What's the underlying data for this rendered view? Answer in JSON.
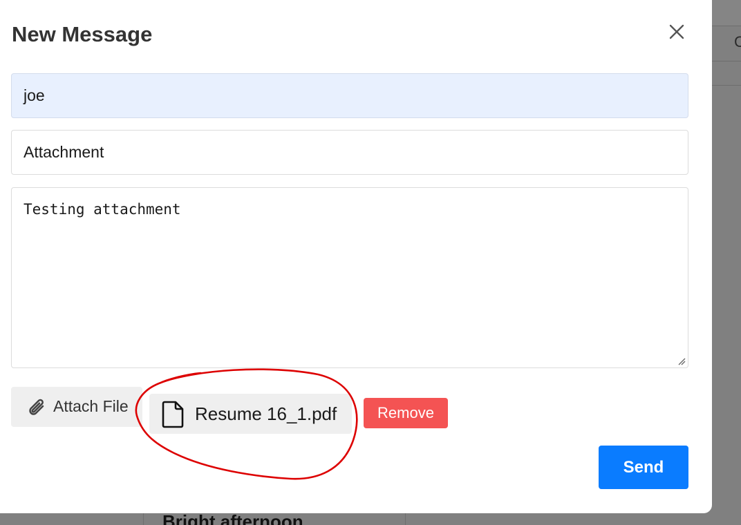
{
  "modal": {
    "title": "New Message",
    "close_icon": "close-icon"
  },
  "form": {
    "to_value": "joe",
    "subject_value": "Attachment",
    "body_value": "Testing attachment"
  },
  "attachments": {
    "attach_button_label": "Attach File",
    "attach_icon": "paperclip-icon",
    "file_icon": "file-icon",
    "file_name": "Resume 16_1.pdf",
    "remove_button_label": "Remove"
  },
  "actions": {
    "send_label": "Send"
  },
  "background": {
    "partial_heading": "Bright afternoon",
    "partial_glyph": "C"
  },
  "colors": {
    "overlay": "#808080",
    "to_field_bg": "#e8f0fe",
    "send_button": "#0a7cff",
    "remove_button": "#f45353",
    "annotation_circle": "#dd0000"
  }
}
